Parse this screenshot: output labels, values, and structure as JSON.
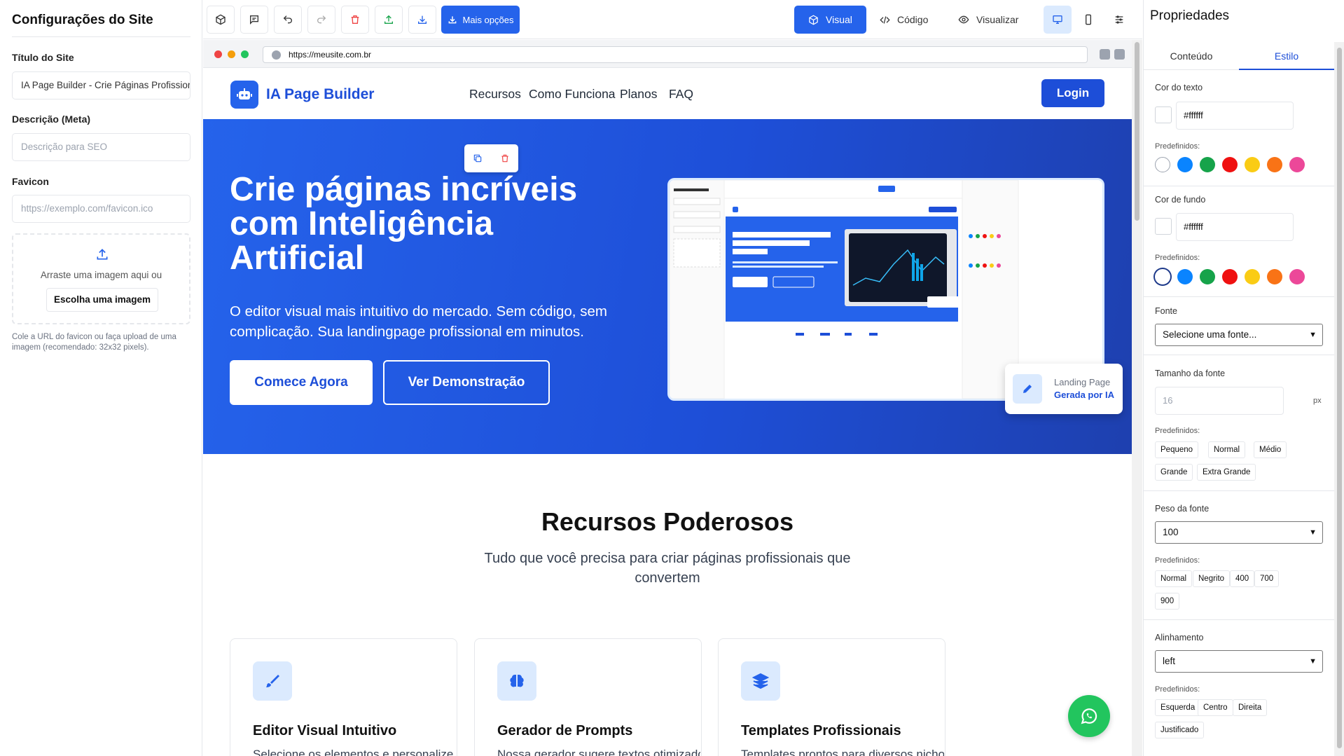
{
  "left_panel": {
    "title": "Configurações do Site",
    "site_title_label": "Título do Site",
    "site_title_value": "IA Page Builder - Crie Páginas Profissionais",
    "description_label": "Descrição (Meta)",
    "description_placeholder": "Descrição para SEO",
    "favicon_label": "Favicon",
    "favicon_placeholder": "https://exemplo.com/favicon.ico",
    "drop_text": "Arraste uma imagem aqui ou",
    "choose_button": "Escolha uma imagem",
    "hint": "Cole a URL do favicon ou faça upload de uma imagem (recomendado: 32x32 pixels)."
  },
  "toolbar": {
    "more_button": "Mais opções",
    "mode_visual": "Visual",
    "mode_code": "Código",
    "mode_preview": "Visualizar"
  },
  "browser": {
    "url": "https://meusite.com.br"
  },
  "site": {
    "brand": "IA Page Builder",
    "nav": [
      "Recursos",
      "Como Funciona",
      "Planos",
      "FAQ"
    ],
    "login": "Login",
    "hero_title": "Crie páginas incríveis com Inteligência Artificial",
    "hero_subtitle": "O editor visual mais intuitivo do mercado. Sem código, sem complicação. Sua landingpage profissional em minutos.",
    "cta_primary": "Comece Agora",
    "cta_secondary": "Ver Demonstração",
    "badge_line1": "Landing Page",
    "badge_line2": "Gerada por IA",
    "features_title": "Recursos Poderosos",
    "features_subtitle": "Tudo que você precisa para criar páginas profissionais que convertem",
    "features": [
      {
        "title": "Editor Visual Intuitivo",
        "desc": "Selecione os elementos e personalize",
        "icon": "brush-icon"
      },
      {
        "title": "Gerador de Prompts",
        "desc": "Nossa gerador sugere textos otimizados",
        "icon": "brain-icon"
      },
      {
        "title": "Templates Profissionais",
        "desc": "Templates prontos para diversos nichos,",
        "icon": "layers-icon"
      }
    ]
  },
  "properties": {
    "title": "Propriedades",
    "tab_content": "Conteúdo",
    "tab_style": "Estilo",
    "text_color_label": "Cor do texto",
    "text_color_value": "#ffffff",
    "presets_label": "Predefinidos:",
    "bg_color_label": "Cor de fundo",
    "bg_color_value": "#ffffff",
    "preset_colors": [
      "#ffffff",
      "#0a84ff",
      "#16a34a",
      "#ef1111",
      "#facc15",
      "#f97316",
      "#ec4899"
    ],
    "font_label": "Fonte",
    "font_value": "Selecione uma fonte...",
    "font_size_label": "Tamanho da fonte",
    "font_size_value": "16",
    "font_size_unit": "px",
    "size_presets": [
      "Pequeno",
      "Normal",
      "Médio",
      "Grande",
      "Extra Grande"
    ],
    "weight_label": "Peso da fonte",
    "weight_value": "100",
    "weight_presets": [
      "Normal",
      "Negrito",
      "400",
      "700",
      "900"
    ],
    "align_label": "Alinhamento",
    "align_value": "left",
    "align_presets": [
      "Esquerda",
      "Centro",
      "Direita",
      "Justificado"
    ]
  }
}
